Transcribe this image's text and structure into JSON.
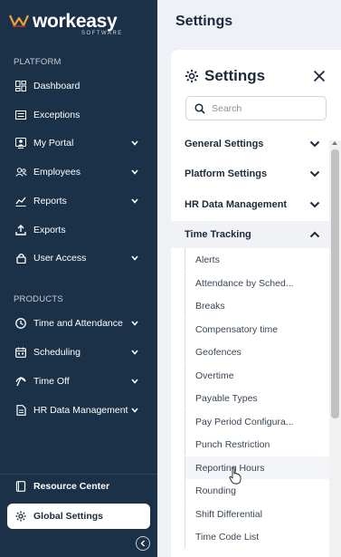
{
  "brand": {
    "name": "workeasy",
    "tagline": "SOFTWARE"
  },
  "sidebar": {
    "platform_label": "PLATFORM",
    "products_label": "PRODUCTS",
    "platform_items": [
      {
        "label": "Dashboard",
        "icon": "dashboard-icon",
        "expandable": false
      },
      {
        "label": "Exceptions",
        "icon": "exceptions-icon",
        "expandable": false
      },
      {
        "label": "My Portal",
        "icon": "portal-icon",
        "expandable": true
      },
      {
        "label": "Employees",
        "icon": "employees-icon",
        "expandable": true
      },
      {
        "label": "Reports",
        "icon": "reports-icon",
        "expandable": true
      },
      {
        "label": "Exports",
        "icon": "exports-icon",
        "expandable": false
      },
      {
        "label": "User Access",
        "icon": "lock-icon",
        "expandable": true
      }
    ],
    "product_items": [
      {
        "label": "Time and Attendance",
        "icon": "clock-icon",
        "expandable": true
      },
      {
        "label": "Scheduling",
        "icon": "calendar-icon",
        "expandable": true
      },
      {
        "label": "Time Off",
        "icon": "time-off-icon",
        "expandable": true
      },
      {
        "label": "HR Data Management",
        "icon": "hr-file-icon",
        "expandable": true
      }
    ],
    "bottom_items": [
      {
        "label": "Resource Center",
        "icon": "book-icon"
      },
      {
        "label": "Global Settings",
        "icon": "gear-icon",
        "active": true
      }
    ]
  },
  "main": {
    "title": "Settings"
  },
  "panel": {
    "title": "Settings",
    "search_placeholder": "Search",
    "groups": [
      {
        "label": "General Settings",
        "open": false
      },
      {
        "label": "Platform Settings",
        "open": false
      },
      {
        "label": "HR Data Management",
        "open": false
      },
      {
        "label": "Time Tracking",
        "open": true
      }
    ],
    "time_tracking_items": [
      "Alerts",
      "Attendance by Sched...",
      "Breaks",
      "Compensatory time",
      "Geofences",
      "Overtime",
      "Payable Types",
      "Pay Period Configura...",
      "Punch Restriction",
      "Reporting Hours",
      "Rounding",
      "Shift Differential",
      "Time Code List"
    ],
    "hovered_item": "Reporting Hours"
  },
  "colors": {
    "sidebar_bg": "#1b3148",
    "accent": "#e8a33a",
    "text_dark": "#1b2a3a"
  }
}
